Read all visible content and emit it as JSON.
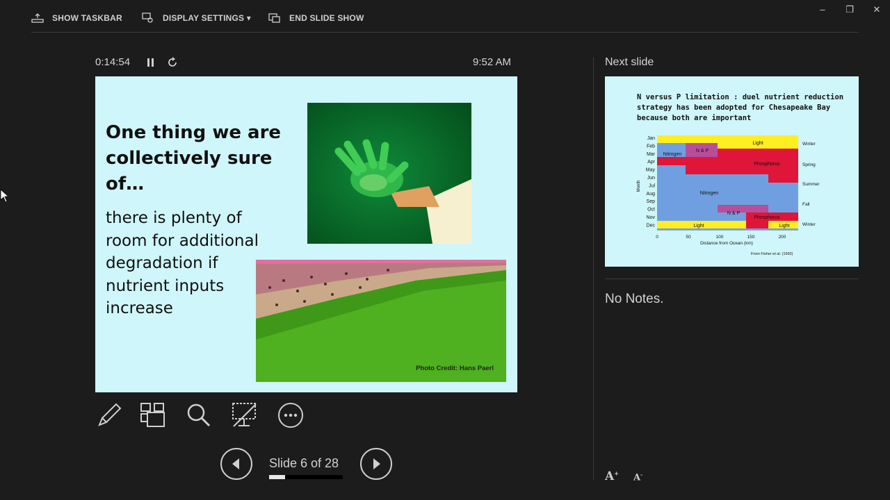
{
  "topbar": {
    "show_taskbar": "SHOW TASKBAR",
    "display_settings": "DISPLAY SETTINGS ▾",
    "end_show": "END SLIDE SHOW",
    "minimize": "–",
    "restore": "❐",
    "close": "✕"
  },
  "presenter": {
    "timer": "0:14:54",
    "clock": "9:52 AM",
    "slide_counter": "Slide 6 of 28",
    "progress_fraction": 0.214
  },
  "current_slide": {
    "title": "One thing we are collectively sure of…",
    "body": "there is plenty of room for additional degradation if nutrient inputs increase",
    "photo_credit": "Photo Credit: Hans Paerl"
  },
  "next_slide": {
    "label": "Next slide",
    "title": "N versus P limitation : duel nutrient reduction strategy has been adopted for Chesapeake Bay because both are important",
    "months": [
      "Jan",
      "Feb",
      "Mar",
      "Apr",
      "May",
      "Jun",
      "Jul",
      "Aug",
      "Sep",
      "Oct",
      "Nov",
      "Dec"
    ],
    "y_axis_label": "Month",
    "seasons": [
      "Winter",
      "Spring",
      "Summer",
      "Fall",
      "Winter"
    ],
    "x_ticks": [
      "0",
      "50",
      "100",
      "150",
      "200"
    ],
    "x_axis_label": "Distance from Ocean (km)",
    "regions": {
      "light_top": "Light",
      "nitrogen_top": "Nitrogen",
      "np_top": "N & P",
      "phosphorus_top": "Phosphorus",
      "nitrogen_mid": "Nitrogen",
      "np_bottom": "N & P",
      "phosphorus_bottom": "Phosphorus",
      "light_bottom_left": "Light",
      "light_bottom_right": "Light"
    },
    "citation": "From Fisher et al. (1992)"
  },
  "notes": {
    "text": "No Notes."
  },
  "colors": {
    "light": "#ffee22",
    "nitrogen": "#6f9fe0",
    "np": "#b84d9a",
    "phosphorus": "#e0153a",
    "slide_bg": "#cff6fa"
  },
  "icons": {
    "tools": [
      "pen-icon",
      "see-all-slides-icon",
      "zoom-icon",
      "black-screen-icon",
      "more-options-icon"
    ],
    "font": [
      "increase-font-icon",
      "decrease-font-icon"
    ]
  }
}
